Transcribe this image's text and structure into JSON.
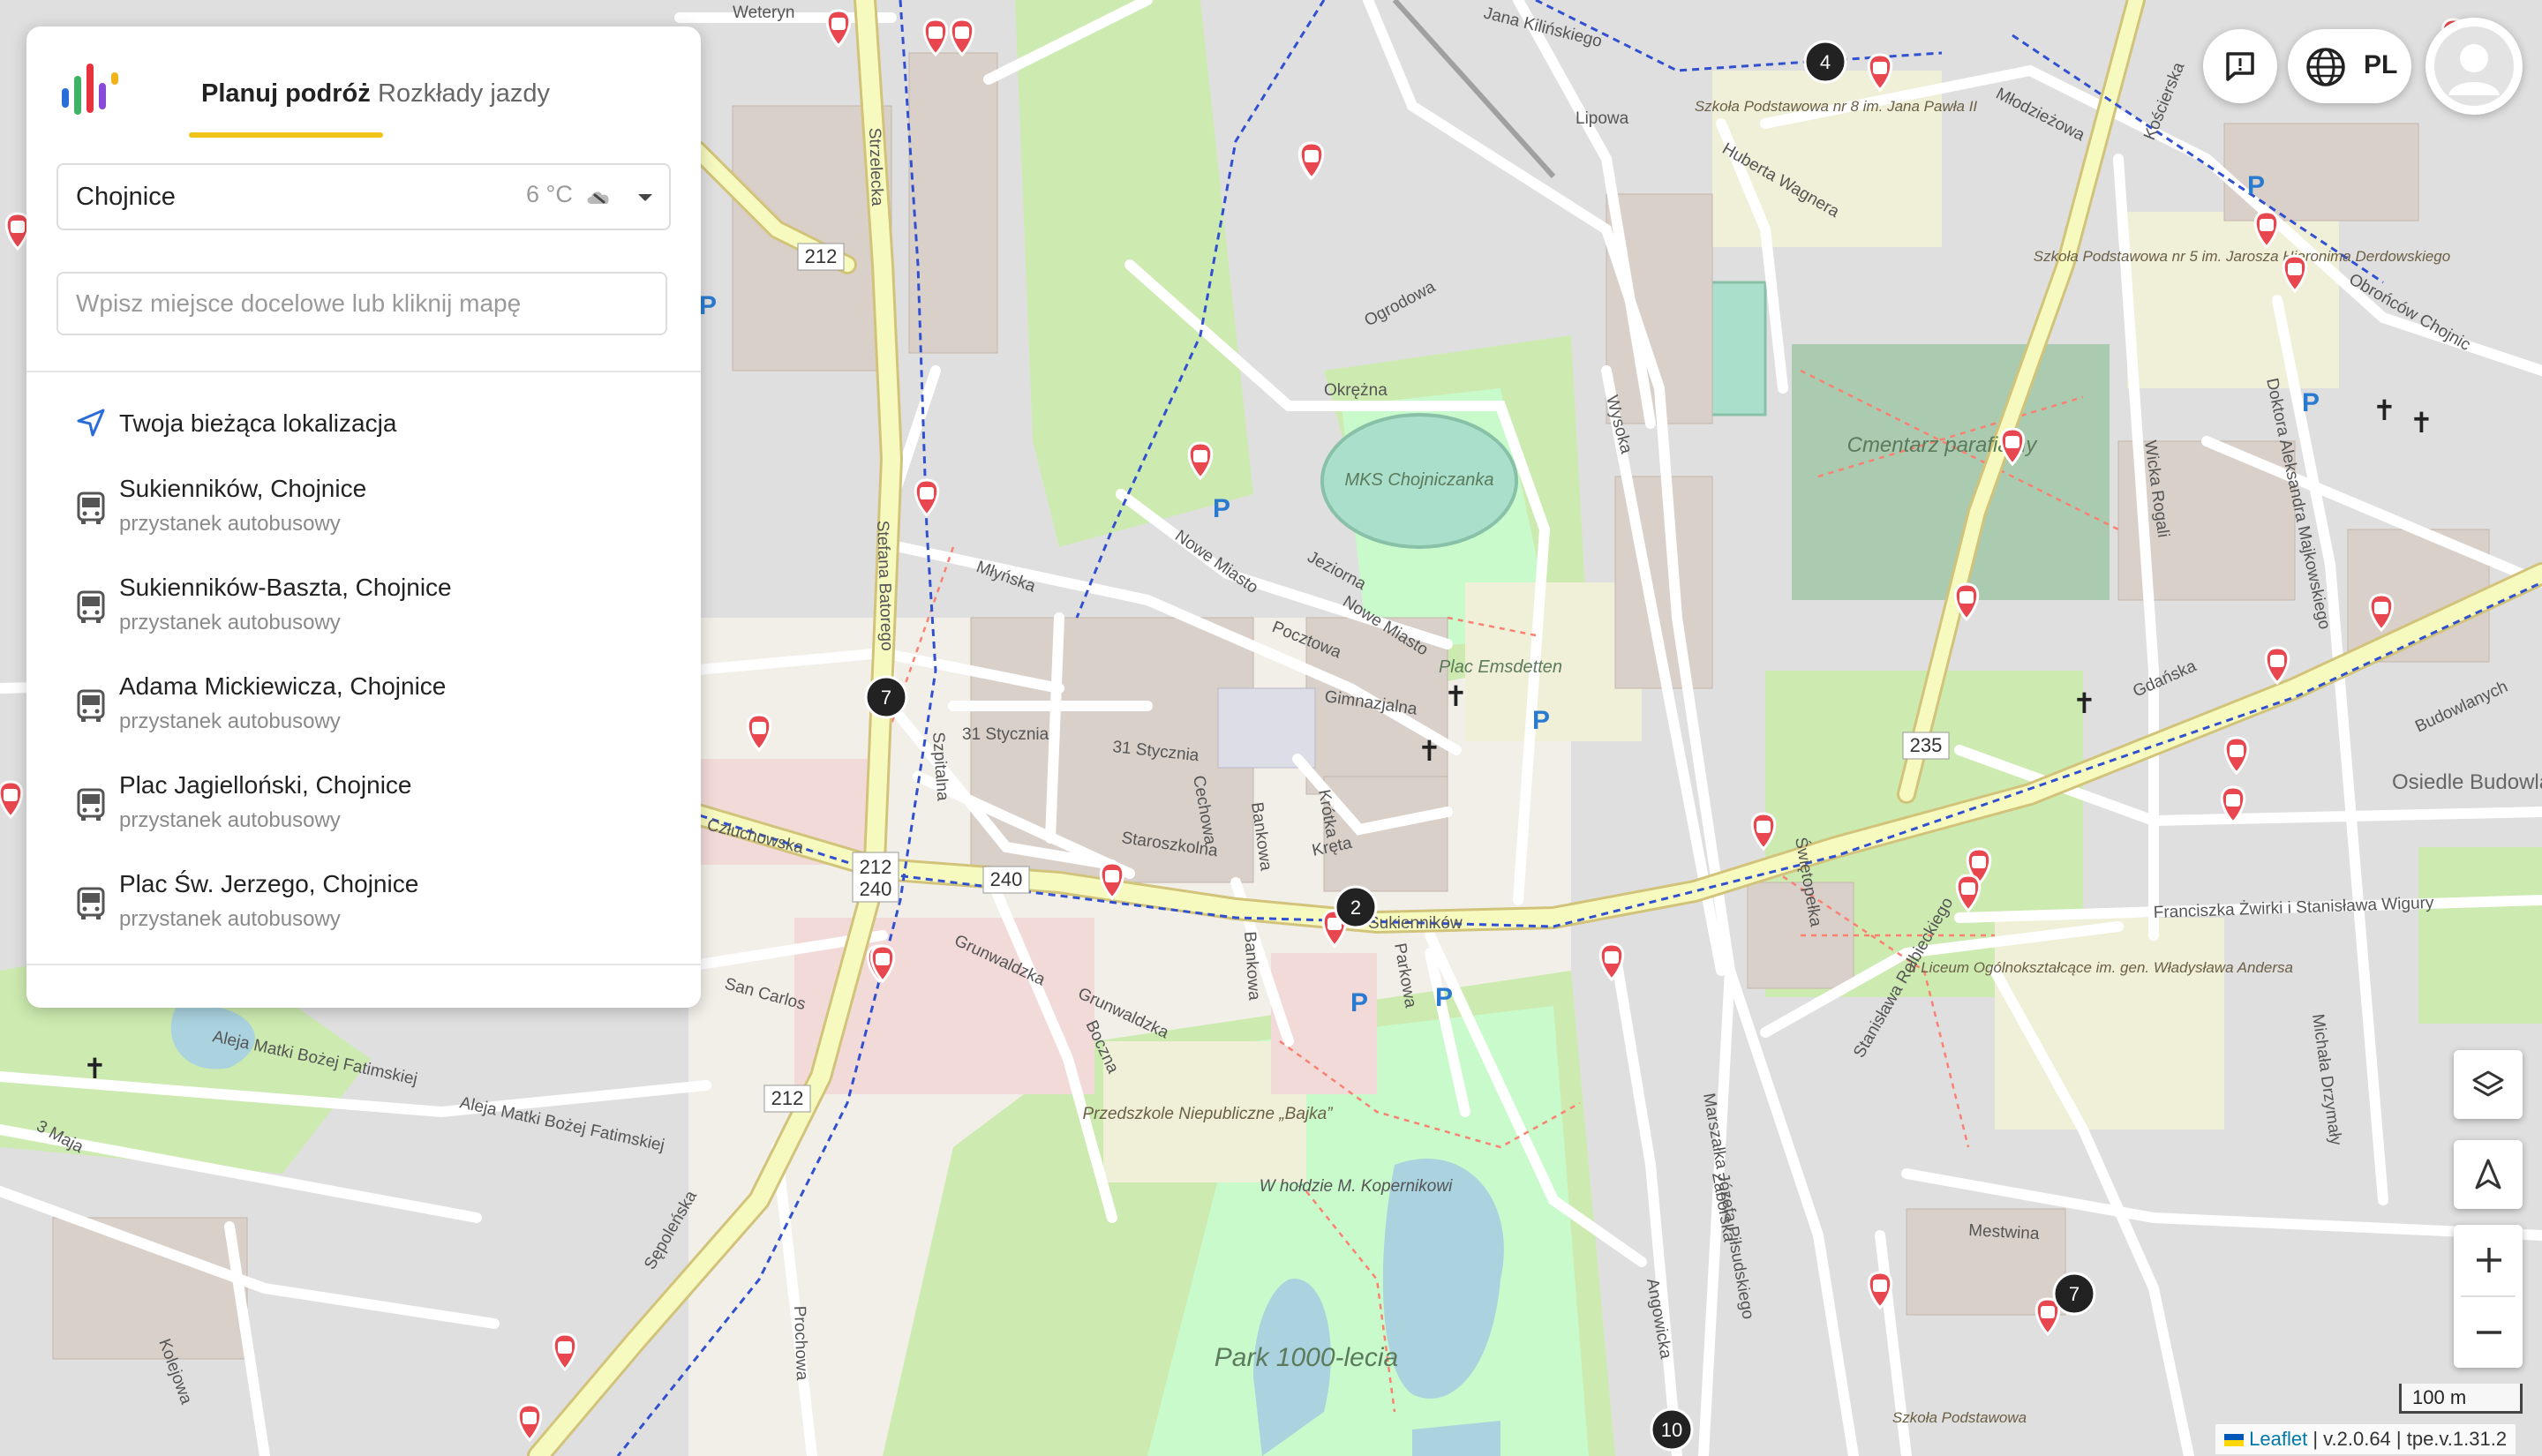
{
  "app": {
    "tabs": {
      "plan": "Planuj podróż",
      "timetables": "Rozkłady jazdy"
    },
    "city": {
      "name": "Chojnice",
      "temperature": "6 °C"
    },
    "search": {
      "placeholder": "Wpisz miejsce docelowe lub kliknij mapę",
      "value": ""
    },
    "suggestions": {
      "current_location": "Twoja bieżąca lokalizacja",
      "stops": [
        {
          "name": "Sukienników, Chojnice",
          "type": "przystanek autobusowy"
        },
        {
          "name": "Sukienników-Baszta, Chojnice",
          "type": "przystanek autobusowy"
        },
        {
          "name": "Adama Mickiewicza, Chojnice",
          "type": "przystanek autobusowy"
        },
        {
          "name": "Plac Jagielloński, Chojnice",
          "type": "przystanek autobusowy"
        },
        {
          "name": "Plac Św. Jerzego, Chojnice",
          "type": "przystanek autobusowy"
        }
      ]
    }
  },
  "header_right": {
    "language": "PL"
  },
  "map": {
    "scale_label": "100 m",
    "attribution": {
      "leaflet": "Leaflet",
      "rest": "| v.2.0.64 | tpe.v.1.31.2"
    },
    "cluster_counts": [
      "4",
      "7",
      "2",
      "7",
      "10"
    ],
    "road_refs": [
      "212",
      "212",
      "240",
      "240",
      "212",
      "235"
    ],
    "street_labels": [
      "Weteryn",
      "Jana Kilińskiego",
      "Lipowa",
      "Hubertа Wagnera",
      "Młodzieżowa",
      "Kościerska",
      "Strzelecka",
      "Ogrodowa",
      "Okrężna",
      "Wysoka",
      "Młyńska",
      "Nowe Miasto",
      "Jeziorna",
      "Pocztowa",
      "Nowe Miasto",
      "Gimnazjalna",
      "31 Stycznia",
      "31 Stycznia",
      "Stefana Batorego",
      "Szpitalna",
      "Człuchowska",
      "Staroszkolna",
      "Cechowa",
      "Bankowa",
      "Krótka",
      "Kręta",
      "Sukienników",
      "Grunwaldzka",
      "Grunwaldzka",
      "Bankowa",
      "Boczna",
      "Parkowa",
      "Aleja Matki Bożej Fatimskiej",
      "Aleja Matki Bożej Fatimskiej",
      "3 Maja",
      "Sępoleńska",
      "Gdańska",
      "Franciszka Żwirki i Stanisława Wigury",
      "Stanisława Rolbieckiego",
      "Świętopełka",
      "Marszałka Józefa Piłsudskiego",
      "Mestwina",
      "Angowicka",
      "Obrońców Chojnic",
      "Budowlanych",
      "Wicka Rogali",
      "Doktora Aleksandra Majkowskiego",
      "Michała Drzymały",
      "Zaborska",
      "Prochowa",
      "Kolejowa",
      "Osiedle Budowlanych",
      "San Carlos"
    ],
    "place_labels": [
      "MKS Chojniczanka",
      "Cmentarz parafialny",
      "Plac Emsdetten",
      "Przedszkole Niepubliczne „Bajka”",
      "W hołdzie M. Kopernikowi",
      "Park 1000-lecia",
      "Szkoła Podstawowa nr 8 im. Jana Pawła II",
      "Szkoła Podstawowa nr 5 im. Jarosza Hieronima Derdowskiego",
      "II Liceum Ogólnokształcące im. gen. Władysława Andersa",
      "Szkoła Podstawowa"
    ]
  }
}
